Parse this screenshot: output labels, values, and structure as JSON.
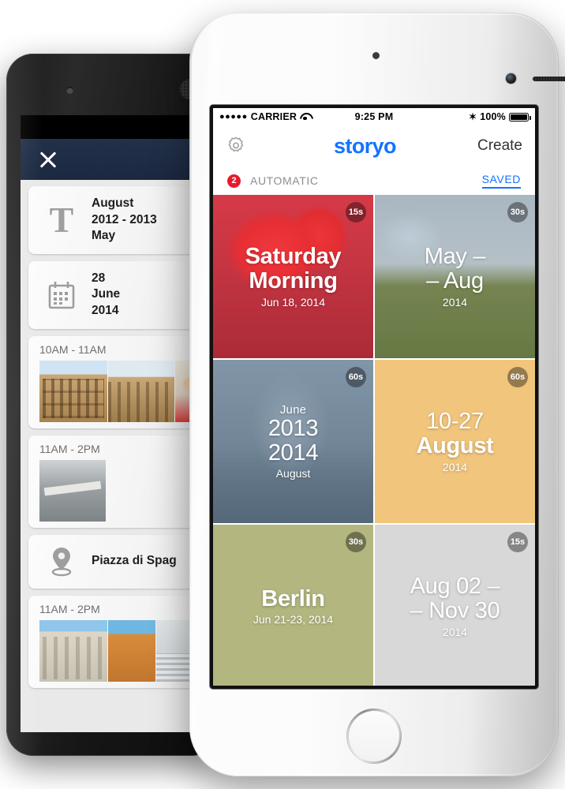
{
  "android": {
    "header": {
      "close_icon": "close-icon"
    },
    "cards": [
      {
        "type": "icon",
        "icon": "text-T-icon",
        "lines": [
          "August",
          "2012 - 2013",
          "May"
        ]
      },
      {
        "type": "icon",
        "icon": "calendar-icon",
        "lines": [
          "28",
          "June",
          "2014"
        ]
      },
      {
        "type": "photos",
        "time": "10AM - 11AM"
      },
      {
        "type": "photos",
        "time": "11AM - 2PM"
      },
      {
        "type": "icon",
        "icon": "location-pin-icon",
        "lines": [
          "Piazza di Spag"
        ]
      },
      {
        "type": "photos",
        "time": "11AM - 2PM"
      }
    ]
  },
  "iphone": {
    "status": {
      "signal_dots": "●●●●●",
      "carrier": "CARRIER",
      "wifi_icon": "wifi-icon",
      "time": "9:25 PM",
      "bluetooth_icon": "✶",
      "battery_pct": "100%"
    },
    "nav": {
      "settings_icon": "gear-icon",
      "logo": "storyo",
      "create_label": "Create"
    },
    "tabs": {
      "badge_count": "2",
      "automatic_label": "AUTOMATIC",
      "saved_label": "SAVED",
      "active": "SAVED"
    },
    "stories": [
      {
        "pre": "",
        "title1": "Saturday",
        "title2": "Morning",
        "sub": "Jun 18, 2014",
        "duration": "15s",
        "photo": "ph-selfie",
        "tint": "red",
        "name": "story-tile-saturday-morning"
      },
      {
        "pre": "",
        "title1": "May –",
        "title2": "– Aug",
        "sub": "2014",
        "duration": "30s",
        "photo": "ph-park",
        "tint": "none",
        "name": "story-tile-may-aug"
      },
      {
        "pre": "June",
        "title1": "2013",
        "title2": "2014",
        "sub": "August",
        "duration": "60s",
        "photo": "ph-harbor",
        "tint": "blue",
        "name": "story-tile-june-2013-2014-august"
      },
      {
        "pre": "",
        "title1": "10-27",
        "title2": "August",
        "sub": "2014",
        "duration": "60s",
        "photo": "ph-gate",
        "tint": "amber",
        "name": "story-tile-10-27-august"
      },
      {
        "pre": "",
        "title1": "Berlin",
        "title2": "",
        "sub": "Jun 21-23, 2014",
        "duration": "30s",
        "photo": "ph-berlin",
        "tint": "olive",
        "name": "story-tile-berlin"
      },
      {
        "pre": "",
        "title1": "Aug 02 –",
        "title2": "– Nov 30",
        "sub": "2014",
        "duration": "15s",
        "photo": "ph-steps",
        "tint": "gray",
        "name": "story-tile-aug-02-nov-30"
      }
    ]
  },
  "colors": {
    "brand_blue": "#1473ff",
    "badge_red": "#e8192c",
    "android_header": "#1b2840",
    "tile_red": "#ed1626",
    "tile_amber": "#e8a22c",
    "tile_olive": "#80862a",
    "tile_blue": "#58748e"
  }
}
